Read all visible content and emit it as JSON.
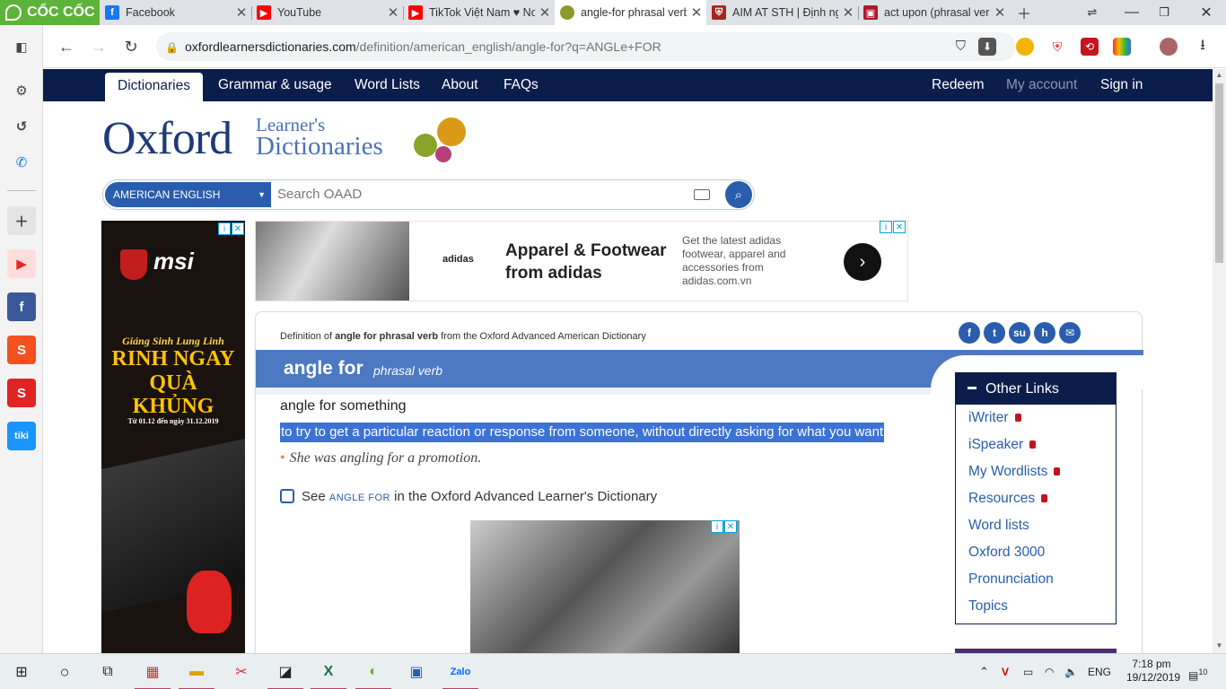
{
  "browser": {
    "brand": "CỐC CỐC",
    "tabs": [
      {
        "title": "Facebook",
        "icon": "facebook-icon",
        "color": "#1877f2"
      },
      {
        "title": "YouTube",
        "icon": "youtube-icon",
        "color": "#ff0000"
      },
      {
        "title": "TikTok Việt Nam ♥ Nơ",
        "icon": "youtube-icon",
        "color": "#ff0000"
      },
      {
        "title": "angle-for phrasal verb",
        "icon": "oxford-balls-icon",
        "color": "#8b9a2a",
        "active": true
      },
      {
        "title": "AIM AT STH | Định ng",
        "icon": "cambridge-icon",
        "color": "#a3271f"
      },
      {
        "title": "act upon (phrasal ver",
        "icon": "book-icon",
        "color": "#b3162c"
      }
    ],
    "url_host": "oxfordlearnersdictionaries.com",
    "url_path": "/definition/american_english/angle-for?q=ANGLe+FOR"
  },
  "site": {
    "nav": {
      "active": "Dictionaries",
      "items": [
        "Grammar & usage",
        "Word Lists",
        "About",
        "FAQs"
      ],
      "right": [
        "Redeem",
        "My account",
        "Sign in"
      ]
    },
    "logo": {
      "main": "Oxford",
      "line1": "Learner's",
      "line2": "Dictionaries"
    },
    "search": {
      "dictionary": "AMERICAN ENGLISH",
      "placeholder": "Search OAAD"
    }
  },
  "ads": {
    "left": {
      "brand": "msi",
      "headline1": "Giáng Sinh Lung Linh",
      "headline2": "RINH NGAY QUÀ KHỦNG",
      "dates": "Từ 01.12 đến ngày 31.12.2019"
    },
    "top": {
      "brand": "adidas",
      "headline": "Apparel & Footwear from adidas",
      "description": "Get the latest adidas footwear, apparel and accessories from adidas.com.vn"
    }
  },
  "entry": {
    "definition_of_prefix": "Definition of",
    "definition_of_term": "angle for phrasal verb",
    "definition_of_suffix": "from the Oxford Advanced American Dictionary",
    "headword": "angle for",
    "pos": "phrasal verb",
    "idiom": "angle for something",
    "definition": "to try to get a particular reaction or response from someone, without directly asking for what you want",
    "example": "She was angling for a promotion.",
    "see_prefix": "See",
    "see_term": "ANGLE FOR",
    "see_suffix": "in the Oxford Advanced Learner's Dictionary"
  },
  "other_links": {
    "title": "Other Links",
    "items": [
      {
        "label": "iWriter",
        "locked": true
      },
      {
        "label": "iSpeaker",
        "locked": true
      },
      {
        "label": "My Wordlists",
        "locked": true
      },
      {
        "label": "Resources",
        "locked": true
      },
      {
        "label": "Word lists",
        "locked": false
      },
      {
        "label": "Oxford 3000",
        "locked": false
      },
      {
        "label": "Pronunciation",
        "locked": false
      },
      {
        "label": "Topics",
        "locked": false
      }
    ]
  },
  "taskbar": {
    "language": "ENG",
    "time": "7:18 pm",
    "date": "19/12/2019",
    "notifications": "10"
  }
}
